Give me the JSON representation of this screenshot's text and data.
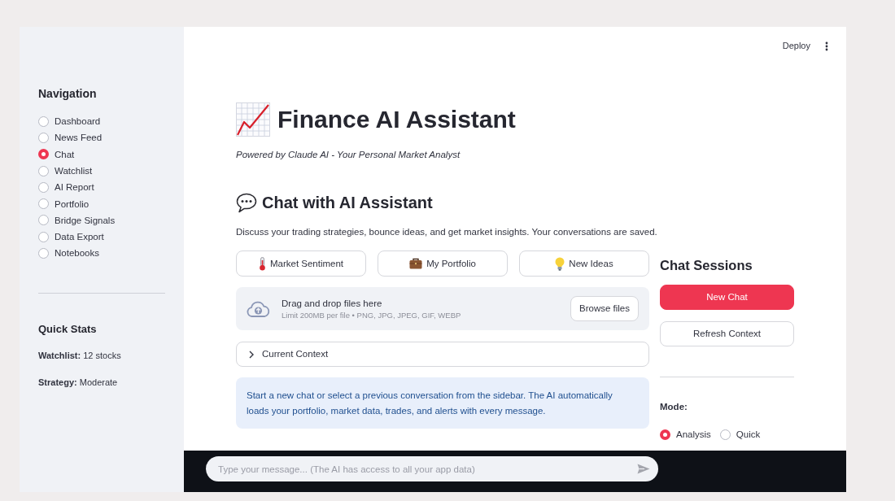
{
  "header": {
    "deploy_label": "Deploy"
  },
  "sidebar": {
    "navigation": {
      "title": "Navigation",
      "items": [
        {
          "label": "Dashboard",
          "selected": false
        },
        {
          "label": "News Feed",
          "selected": false
        },
        {
          "label": "Chat",
          "selected": true
        },
        {
          "label": "Watchlist",
          "selected": false
        },
        {
          "label": "AI Report",
          "selected": false
        },
        {
          "label": "Portfolio",
          "selected": false
        },
        {
          "label": "Bridge Signals",
          "selected": false
        },
        {
          "label": "Data Export",
          "selected": false
        },
        {
          "label": "Notebooks",
          "selected": false
        }
      ]
    },
    "quick_stats": {
      "title": "Quick Stats",
      "stats": [
        "**Watchlist:** 12 stocks",
        "**Strategy:** Moderate"
      ]
    }
  },
  "main": {
    "title": "Finance AI Assistant",
    "subtitle": "Powered by Claude AI - Your Personal Market Analyst",
    "section_title": "Chat with AI Assistant",
    "description": "Discuss your trading strategies, bounce ideas, and get market insights. Your conversations are saved.",
    "quick_actions": [
      "Market Sentiment",
      "My Portfolio",
      "New Ideas"
    ],
    "uploader": {
      "title": "Drag and drop files here",
      "hint": "Limit 200MB per file • PNG, JPG, JPEG, GIF, WEBP",
      "button": "Browse files"
    },
    "expander": {
      "label": "Current Context",
      "expanded": false
    },
    "info": "Start a new chat or select a previous conversation from the sidebar. The AI automatically loads your portfolio, market data, trades, and alerts with every message."
  },
  "sessions": {
    "title": "Chat Sessions",
    "buttons": [
      {
        "label": "New Chat",
        "kind": "primary"
      },
      {
        "label": "Refresh Context",
        "kind": "secondary"
      }
    ],
    "mode": {
      "label": "Mode:",
      "options": [
        {
          "label": "Analysis",
          "selected": true
        },
        {
          "label": "Quick",
          "selected": false
        }
      ]
    }
  },
  "chat_input": {
    "placeholder": "Type your message... (The AI has access to all your app data)"
  }
}
